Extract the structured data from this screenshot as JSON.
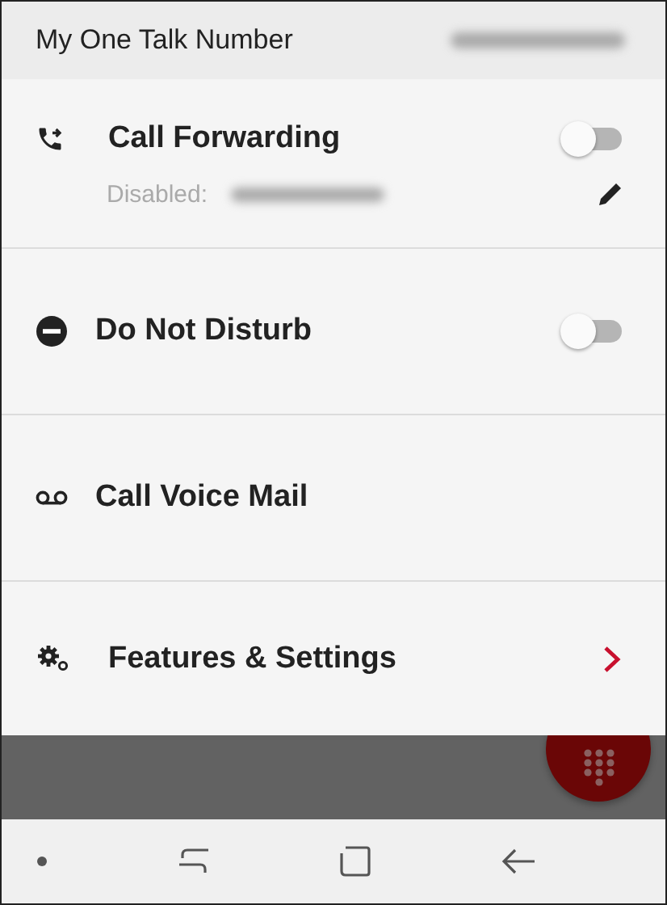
{
  "header": {
    "title": "My One Talk Number"
  },
  "rows": [
    {
      "kind": "toggle",
      "label": "Call Forwarding",
      "on": false,
      "sublabel": "Disabled:"
    },
    {
      "kind": "toggle",
      "label": "Do Not Disturb",
      "on": false
    },
    {
      "kind": "plain",
      "label": "Call Voice Mail"
    },
    {
      "kind": "link",
      "label": "Features & Settings"
    }
  ]
}
